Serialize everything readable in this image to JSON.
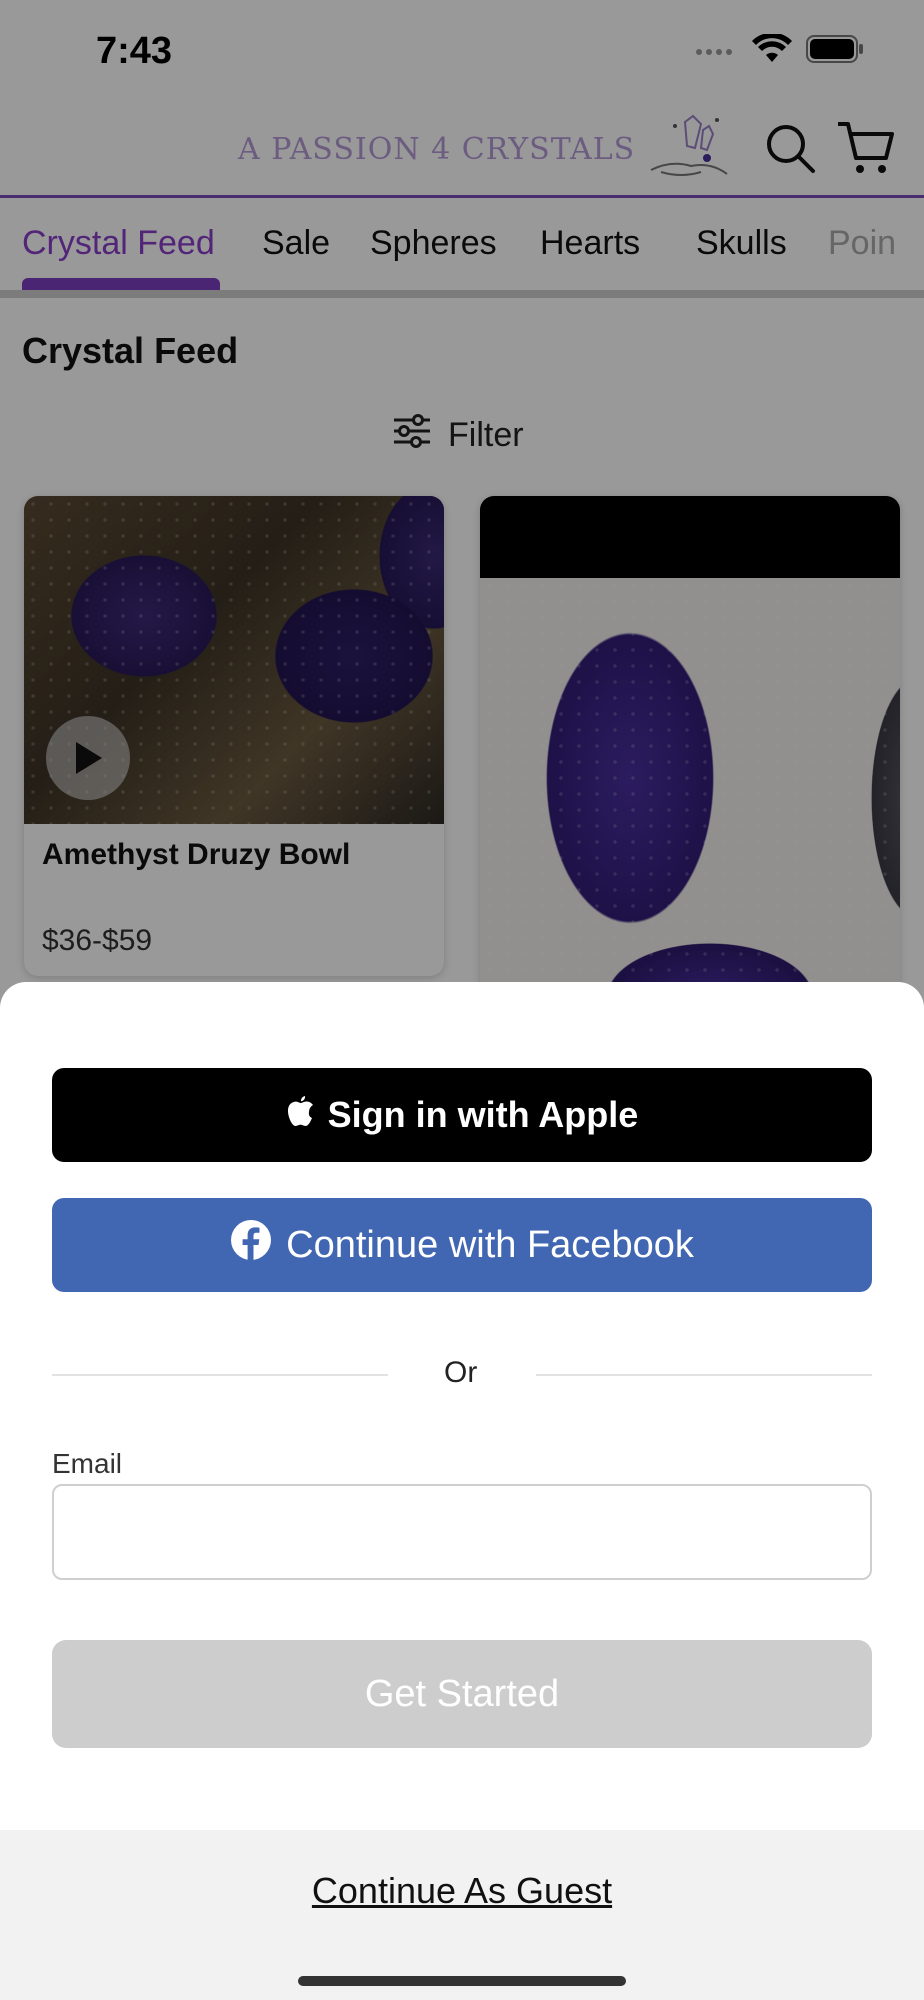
{
  "status_bar": {
    "time": "7:43"
  },
  "header": {
    "logo_text": "A PASSION 4 CRYSTALS",
    "search_icon": "search-icon",
    "cart_icon": "cart-icon"
  },
  "tabs": [
    {
      "label": "Crystal Feed",
      "active": true
    },
    {
      "label": "Sale"
    },
    {
      "label": "Spheres"
    },
    {
      "label": "Hearts"
    },
    {
      "label": "Skulls"
    },
    {
      "label": "Poin"
    }
  ],
  "feed": {
    "title": "Crystal Feed",
    "filter_label": "Filter",
    "products": [
      {
        "name": "Amethyst Druzy Bowl",
        "price": "$36-$59",
        "has_video": true
      }
    ]
  },
  "sheet": {
    "apple_label": "Sign in with Apple",
    "facebook_label": "Continue with Facebook",
    "or_text": "Or",
    "email_label": "Email",
    "email_value": "",
    "get_started_label": "Get Started",
    "guest_label": "Continue As Guest"
  },
  "colors": {
    "accent_purple": "#8a3fc9",
    "facebook_blue": "#4267b2",
    "disabled_gray": "#cdcdcd"
  }
}
